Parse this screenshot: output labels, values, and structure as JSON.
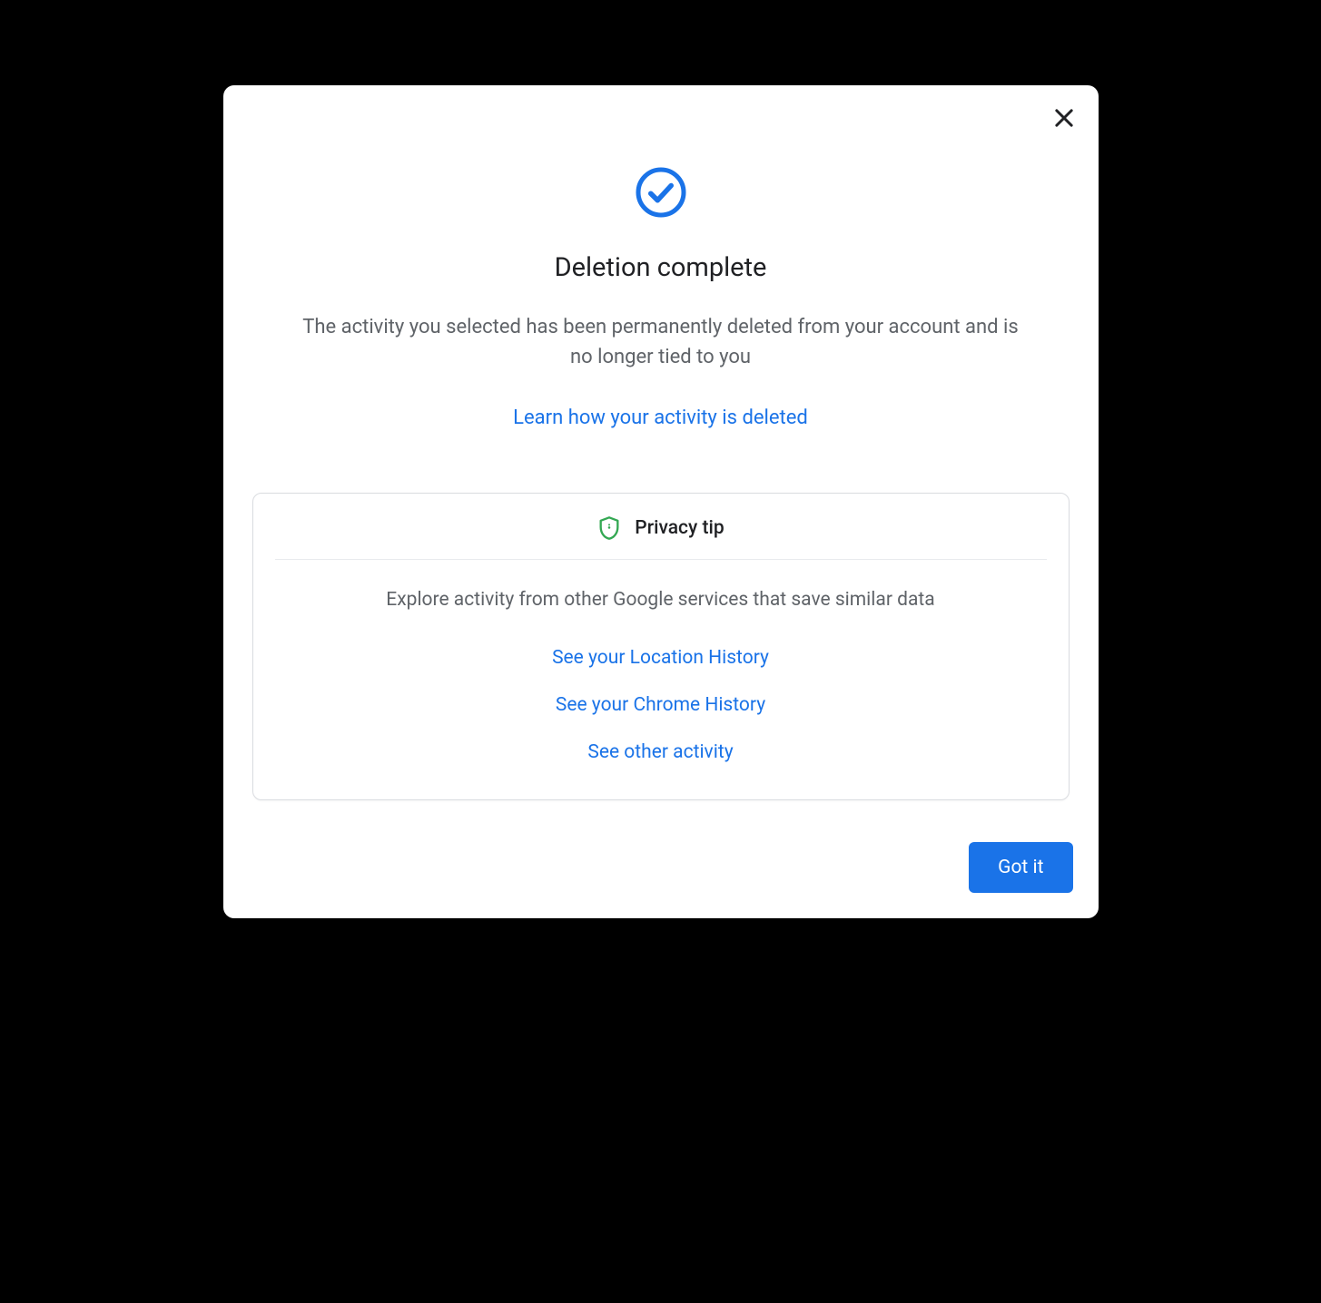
{
  "dialog": {
    "title": "Deletion complete",
    "description": "The activity you selected has been permanently deleted from your account and is no longer tied to you",
    "learn_link": "Learn how your activity is deleted"
  },
  "privacy_card": {
    "title": "Privacy tip",
    "description": "Explore activity from other Google services that save similar data",
    "links": [
      "See your Location History",
      "See your Chrome History",
      "See other activity"
    ]
  },
  "footer": {
    "got_it_label": "Got it"
  },
  "colors": {
    "primary": "#1a73e8",
    "shield_green": "#34a853"
  }
}
